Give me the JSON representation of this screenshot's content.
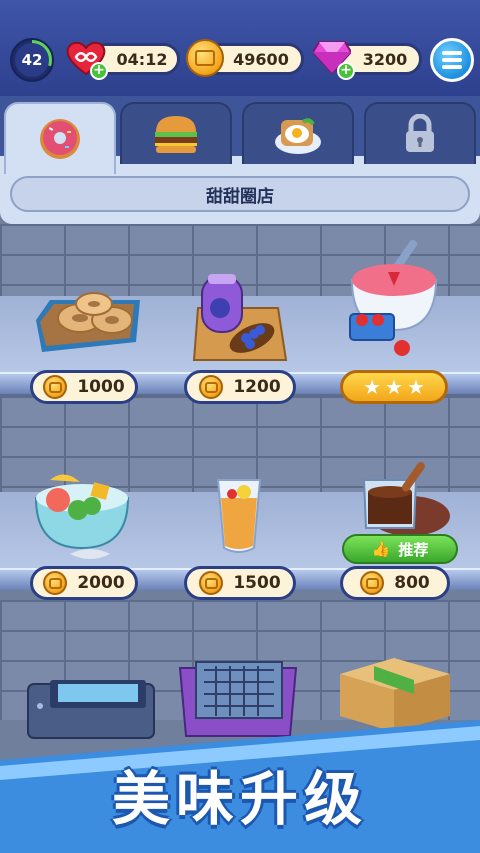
{
  "hud": {
    "level": "42",
    "lives_timer": "04:12",
    "coins": "49600",
    "gems": "3200",
    "icons": [
      "level-ring-icon",
      "heart-infinity-icon",
      "gold-coin-icon",
      "pink-gem-icon",
      "menu-icon"
    ]
  },
  "tabs": [
    {
      "name": "tab-donut",
      "icon": "donut-icon",
      "active": true
    },
    {
      "name": "tab-burger",
      "icon": "burger-icon",
      "active": false
    },
    {
      "name": "tab-breakfast",
      "icon": "fried-egg-toast-icon",
      "active": false
    },
    {
      "name": "tab-locked",
      "icon": "lock-icon",
      "active": false
    }
  ],
  "shop_title": "甜甜圈店",
  "items": [
    {
      "name": "bagel-tray",
      "price": "1000"
    },
    {
      "name": "blueberry-jam",
      "price": "1200"
    },
    {
      "name": "strawberry-soup",
      "stars": 3
    },
    {
      "name": "fruit-salad",
      "price": "2000"
    },
    {
      "name": "juice-glass",
      "price": "1500"
    },
    {
      "name": "chocolate-pudding",
      "price": "800",
      "badge": "推荐"
    }
  ],
  "banner_text": "美味升级",
  "colors": {
    "accent_blue": "#2b3f86",
    "coin_gold": "#f3a51c",
    "recommend_green": "#3aa82b"
  }
}
